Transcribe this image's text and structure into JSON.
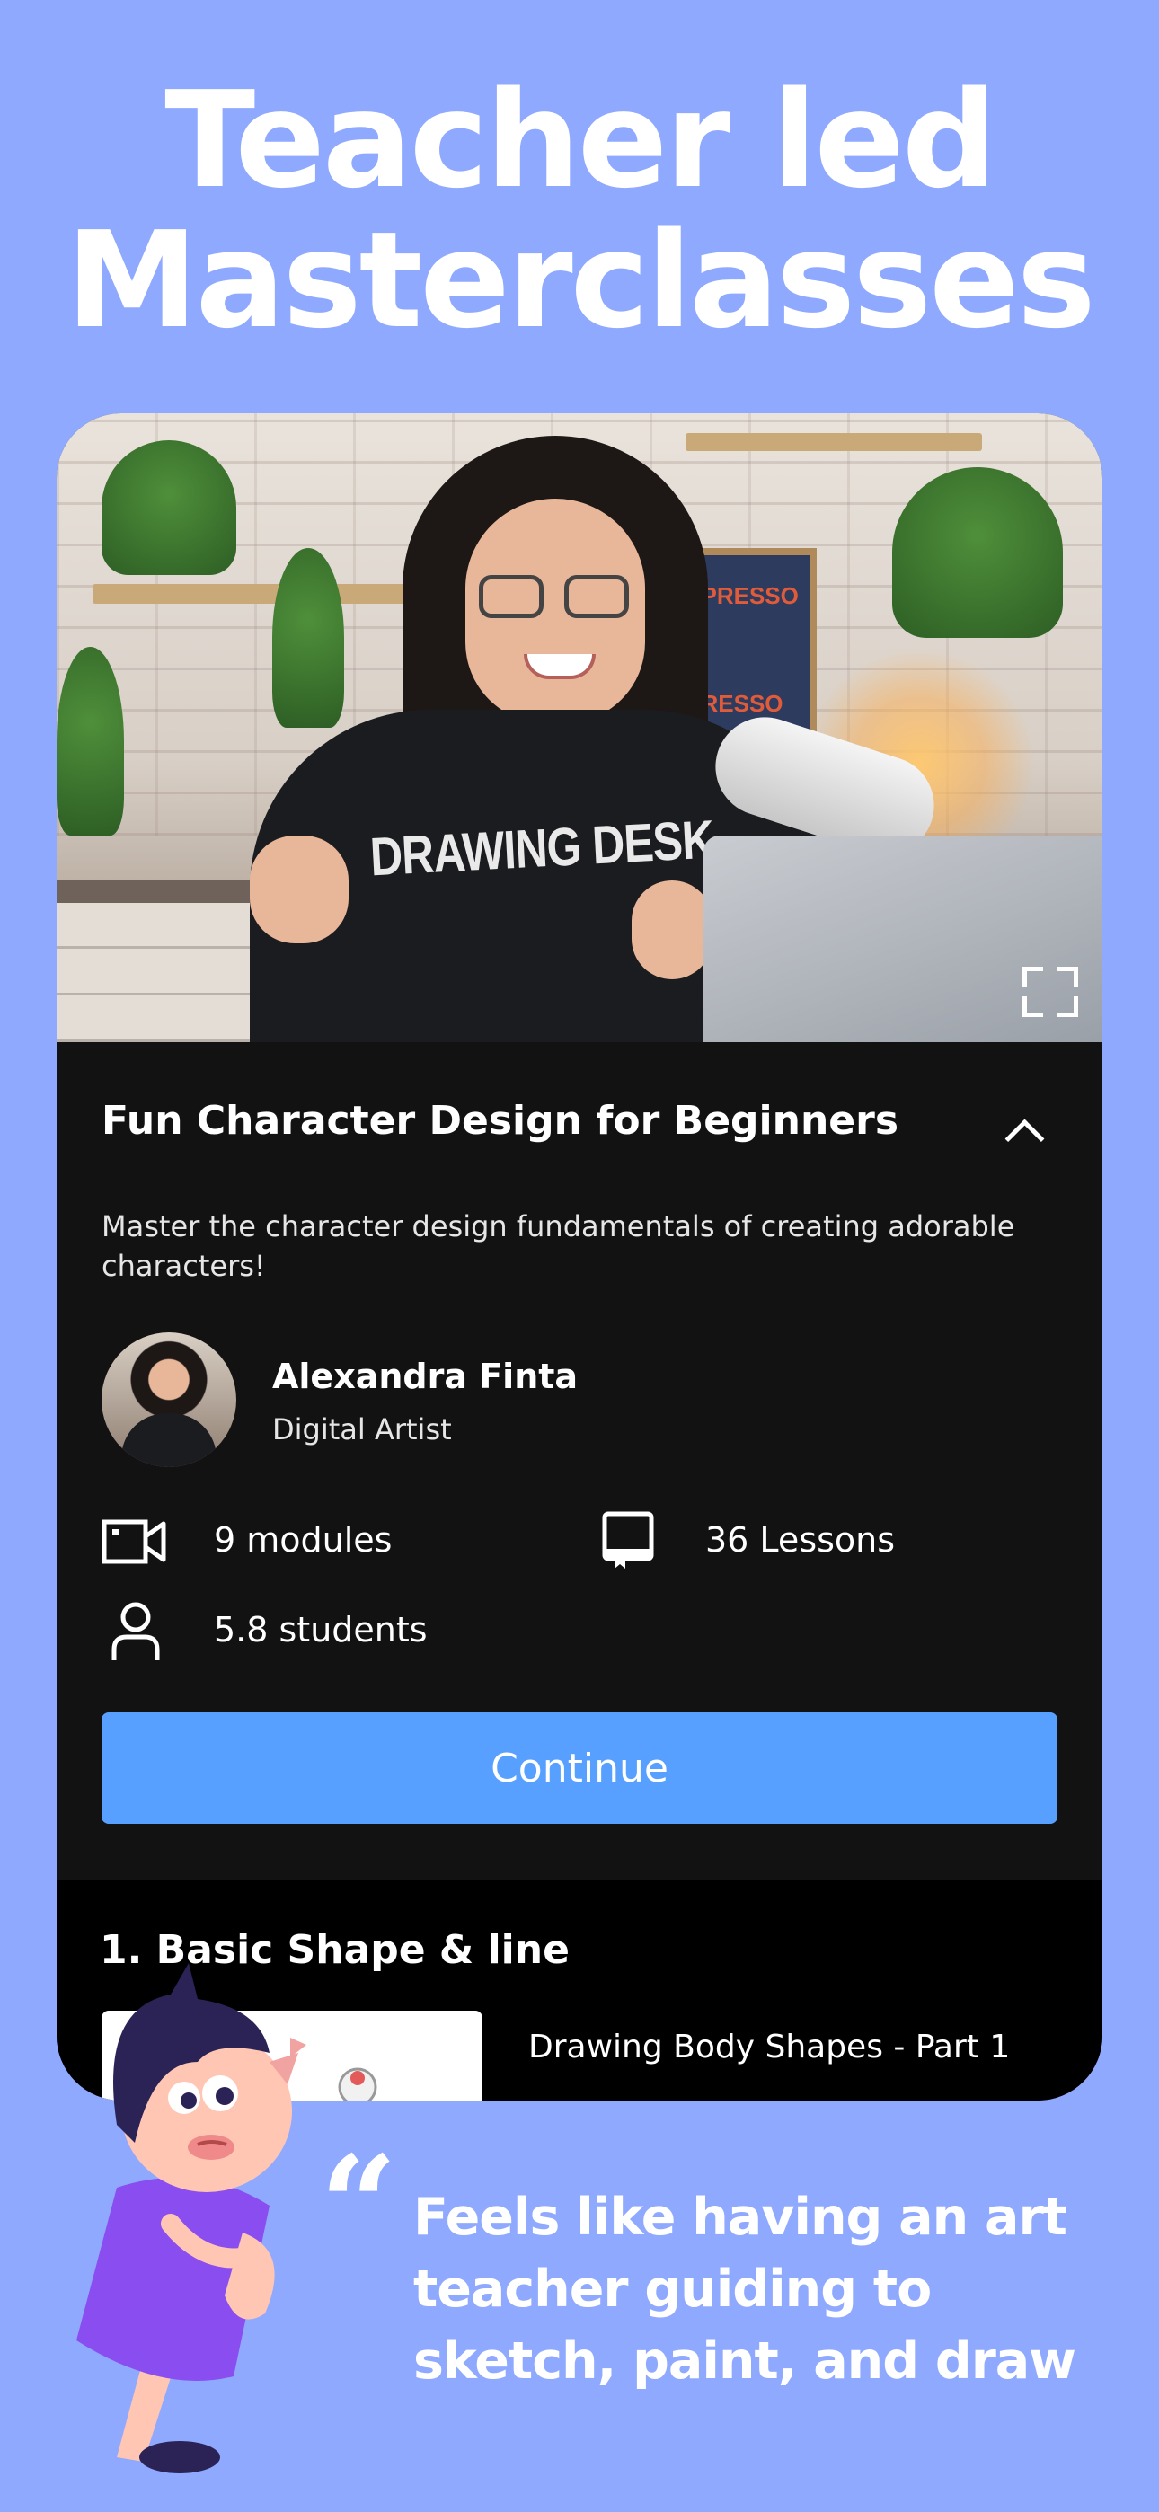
{
  "headline": {
    "line1": "Teacher led",
    "line2": "Masterclasses"
  },
  "video": {
    "shirt_text": "DRAWING DESK",
    "poster_text_1": "SPRESSO",
    "poster_text_2": "RESSO",
    "fullscreen_icon": "fullscreen-icon"
  },
  "course": {
    "title": "Fun Character Design for Beginners",
    "description": "Master the character design fundamentals of creating adorable characters!",
    "collapse_icon": "chevron-up-icon"
  },
  "instructor": {
    "name": "Alexandra Finta",
    "role": "Digital Artist"
  },
  "stats": {
    "modules": "9 modules",
    "lessons": "36 Lessons",
    "students": "5.8 students"
  },
  "continue_label": "Continue",
  "module": {
    "title": "1. Basic Shape & line",
    "collapse_icon": "chevron-up-icon"
  },
  "lesson": {
    "title": "Drawing Body Shapes - Part 1"
  },
  "quote_mark": "“",
  "testimonial": {
    "line1": "Feels like having an art",
    "line2": "teacher guiding to",
    "line3": "sketch, paint, and draw"
  },
  "colors": {
    "background": "#8fa9ff",
    "card": "#121212",
    "button": "#57a0ff",
    "mascot_hair": "#2b2356",
    "mascot_dress": "#8a4df0"
  }
}
